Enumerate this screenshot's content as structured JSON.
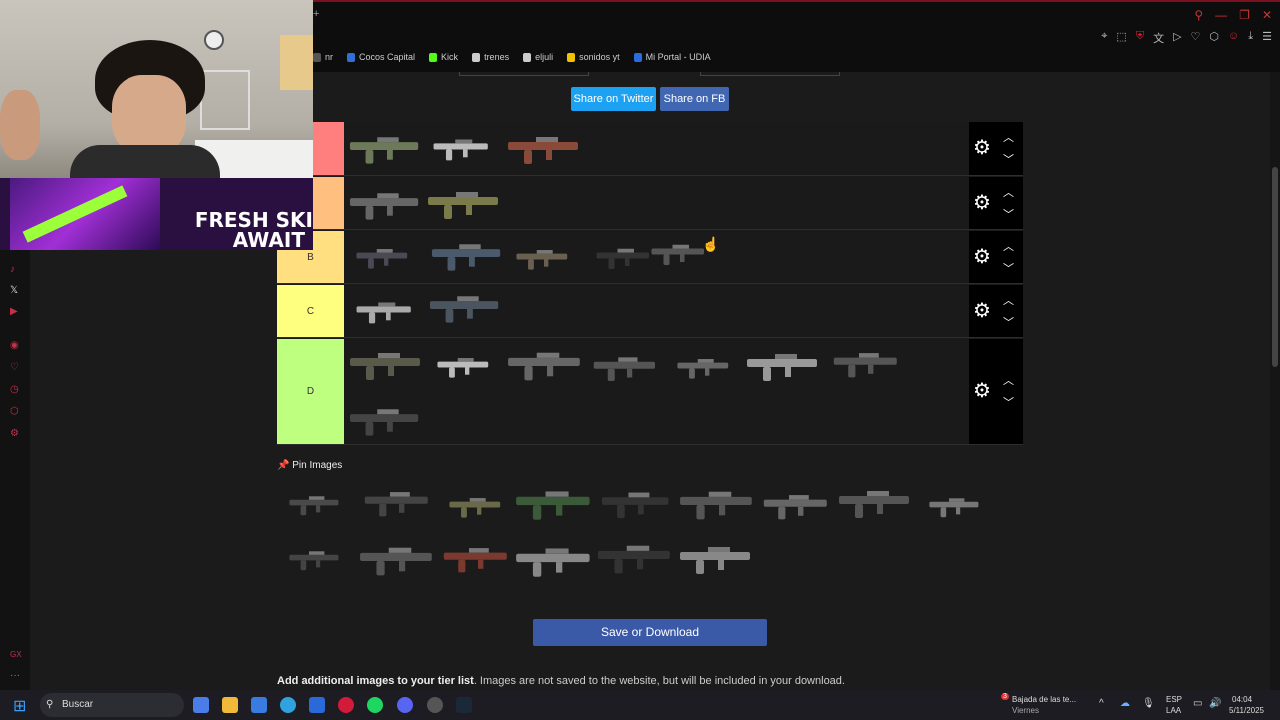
{
  "browser": {
    "bookmarks": [
      {
        "label": "nr",
        "color": "#555555"
      },
      {
        "label": "Cocos Capital",
        "color": "#2f6fd6"
      },
      {
        "label": "Kick",
        "color": "#53fc18"
      },
      {
        "label": "trenes",
        "color": "#cccccc"
      },
      {
        "label": "eljuli",
        "color": "#cccccc"
      },
      {
        "label": "sonidos yt",
        "color": "#f2c200"
      },
      {
        "label": "Mi Portal - UDIA",
        "color": "#2b6be0"
      }
    ]
  },
  "share": {
    "twitter_label": "Share on Twitter",
    "fb_label": "Share on FB",
    "twitter_color": "#1da1f2",
    "fb_color": "#4267b2"
  },
  "tiers": [
    {
      "label": "",
      "color": "#ff7f7f"
    },
    {
      "label": "",
      "color": "#ffbf7f"
    },
    {
      "label": "B",
      "color": "#ffdf7f"
    },
    {
      "label": "C",
      "color": "#ffff7f"
    },
    {
      "label": "D",
      "color": "#bfff7f"
    }
  ],
  "pin": {
    "label": "Pin Images",
    "icon": "pushpin-icon"
  },
  "save_label": "Save or Download",
  "add_images": {
    "bold": "Add additional images to your tier list",
    "rest": ". Images are not saved to the website, but will be included in your download."
  },
  "stream": {
    "banner_line1": "FRESH SKI",
    "banner_line2": "AWAIT"
  },
  "taskbar": {
    "search_placeholder": "Buscar",
    "media_title": "Bajada de las te...",
    "media_sub": "Viernes",
    "media_badge": "3",
    "lang_top": "ESP",
    "lang_bottom": "LAA",
    "time": "04:04",
    "date": "5/11/2025"
  }
}
